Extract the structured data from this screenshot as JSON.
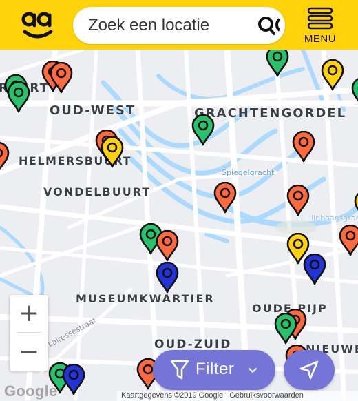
{
  "header": {
    "logo_icon": "smiley-logo-icon",
    "search_placeholder": "Zoek een locatie",
    "search_icon": "search-icon",
    "menu_label": "MENU",
    "menu_icon": "hamburger-icon",
    "background": "#FFD20A"
  },
  "map": {
    "labels": [
      "RPURT",
      "OUD-WEST",
      "GRACHTENGORDEL",
      "HELMERSBUURT",
      "VONDELBUURT",
      "MUSEUMKWARTIER",
      "OUDE PIJP",
      "OUD-ZUID",
      "NIEUWE",
      "Spiegelgracht",
      "Lairessestraat",
      "Lijnbaansgracht"
    ],
    "pin_colors": {
      "green": "#27c26b",
      "orange": "#ff6a3d",
      "yellow": "#ffd20a",
      "blue": "#2234d8"
    }
  },
  "controls": {
    "zoom_in": "+",
    "zoom_out": "−",
    "filter_label": "Filter",
    "filter_icon": "funnel-icon",
    "filter_chevron": "chevron-down-icon",
    "locate_icon": "navigation-arrow-icon",
    "button_color": "#7475d6"
  },
  "footer": {
    "google_logo": "Google",
    "attribution": "Kaartgegevens ©2019 Google",
    "terms_link": "Gebruiksvoorwaarden"
  }
}
